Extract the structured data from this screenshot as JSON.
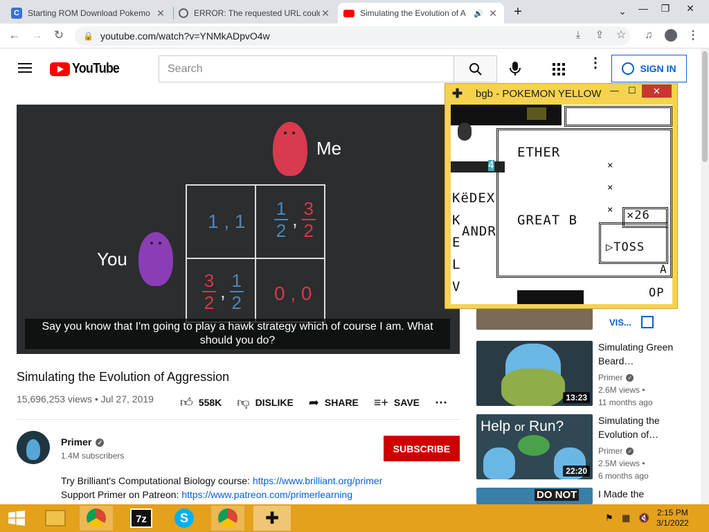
{
  "browser": {
    "tabs": [
      {
        "title": "Starting ROM Download Pokemo",
        "icon": "c-logo-icon"
      },
      {
        "title": "ERROR: The requested URL could",
        "icon": "globe-icon"
      },
      {
        "title": "Simulating the Evolution of A",
        "icon": "youtube-icon",
        "active": true
      }
    ],
    "new_tab": "+",
    "url": "youtube.com/watch?v=YNMkADpvO4w"
  },
  "youtube": {
    "logo": "YouTube",
    "search_placeholder": "Search",
    "sign_in": "SIGN IN",
    "video": {
      "me_label": "Me",
      "you_label": "You",
      "cell_11": "1 , 1",
      "cell_00": "0 , 0",
      "frac_num_1": "1",
      "frac_den_2": "2",
      "frac_num_3": "3",
      "caption": "Say you know that I'm going to play a hawk strategy which of course I am. What should you do?",
      "title": "Simulating the Evolution of Aggression",
      "meta": "15,696,253 views • Jul 27, 2019",
      "likes": "558K",
      "dislike": "DISLIKE",
      "share": "SHARE",
      "save": "SAVE"
    },
    "channel": {
      "name": "Primer",
      "subs": "1.4M subscribers",
      "subscribe": "SUBSCRIBE"
    },
    "description": [
      {
        "text": "Try Brilliant's Computational Biology course: ",
        "link": "https://www.brilliant.org/primer"
      },
      {
        "text": "Support Primer on Patreon: ",
        "link": "https://www.patreon.com/primerlearning"
      }
    ],
    "visit": "VIS...",
    "related": [
      {
        "title": "Simulating Green Beard…",
        "channel": "Primer",
        "views": "2.6M views •",
        "age": "11 months ago",
        "duration": "13:23"
      },
      {
        "title": "Simulating the Evolution of…",
        "channel": "Primer",
        "views": "2.5M views •",
        "age": "6 months ago",
        "duration": "22:20",
        "thumb_text_a": "Help",
        "thumb_text_b": "or",
        "thumb_text_c": "Run?"
      },
      {
        "title": "I Made the",
        "thumb_text": "DO NOT"
      }
    ]
  },
  "emulator": {
    "title": "bgb - POKEMON YELLOW",
    "lines": {
      "ether": "ETHER",
      "kedex": "KëDEX",
      "k": "K",
      "andr": "ANDR",
      "great": "GREAT B",
      "e": "E",
      "l": "L",
      "v": "V",
      "x26": "×26",
      "toss": "▷TOSS",
      "op": "OP",
      "a": "A",
      "four": "4",
      "x1": "×",
      "x2": "×",
      "x3": "×"
    }
  },
  "taskbar": {
    "time": "2:15 PM",
    "date": "3/1/2022"
  }
}
